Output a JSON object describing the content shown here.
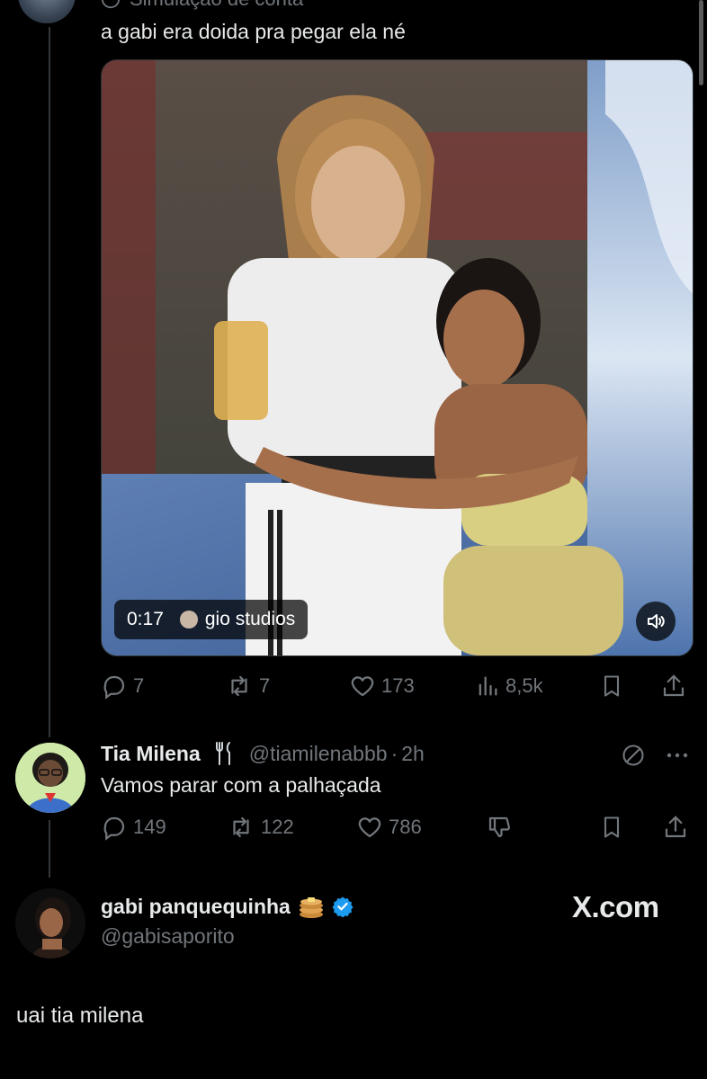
{
  "post1": {
    "context_label": "Simulação de conta",
    "text": "a gabi era doida pra pegar ela né",
    "video": {
      "timestamp": "0:17",
      "source_name": "gio studios",
      "volume_icon": "volume-icon"
    },
    "actions": {
      "replies": "7",
      "reposts": "7",
      "likes": "173",
      "views": "8,5k"
    }
  },
  "post2": {
    "display_name": "Tia Milena",
    "name_emoji": "fork-knife-icon",
    "handle": "@tiamilenabbb",
    "separator": "·",
    "time": "2h",
    "text": "Vamos parar com a palhaçada",
    "actions": {
      "replies": "149",
      "reposts": "122",
      "likes": "786"
    }
  },
  "post3": {
    "display_name": "gabi panquequinha",
    "name_emoji": "pancakes-icon",
    "verified": true,
    "handle": "@gabisaporito",
    "text": "uai tia milena"
  },
  "watermark": "X.com",
  "colors": {
    "background": "#000000",
    "text": "#e7e9ea",
    "muted": "#71767b",
    "verified": "#1d9bf0"
  }
}
